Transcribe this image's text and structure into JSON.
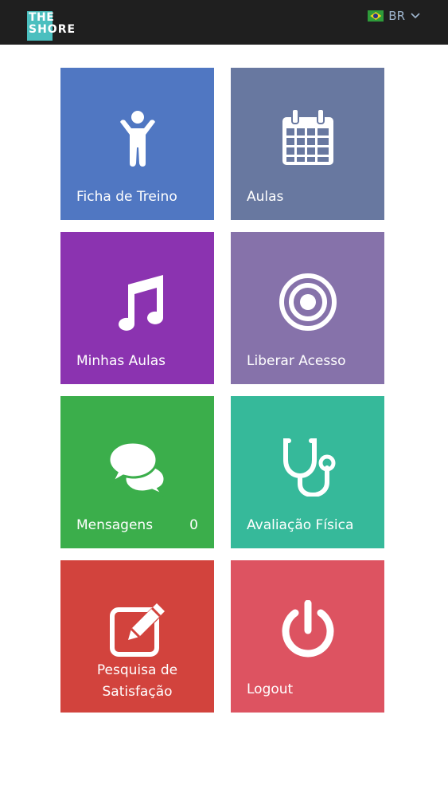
{
  "header": {
    "logo_line1": "THE",
    "logo_line2": "SHORE",
    "language": "BR"
  },
  "tiles": [
    {
      "label": "Ficha de Treino",
      "icon": "person-icon",
      "color": "#5077c2"
    },
    {
      "label": "Aulas",
      "icon": "calendar-icon",
      "color": "#6878a0"
    },
    {
      "label": "Minhas Aulas",
      "icon": "music-note-icon",
      "color": "#8b33b0"
    },
    {
      "label": "Liberar Acesso",
      "icon": "target-icon",
      "color": "#8672aa"
    },
    {
      "label": "Mensagens",
      "icon": "chat-bubbles-icon",
      "color": "#3bae4b",
      "count": "0"
    },
    {
      "label": "Avaliação Física",
      "icon": "stethoscope-icon",
      "color": "#36b99a"
    },
    {
      "label": "Pesquisa de Satisfação",
      "icon": "edit-icon",
      "color": "#d2433d"
    },
    {
      "label": "Logout",
      "icon": "power-icon",
      "color": "#dd5361"
    }
  ]
}
